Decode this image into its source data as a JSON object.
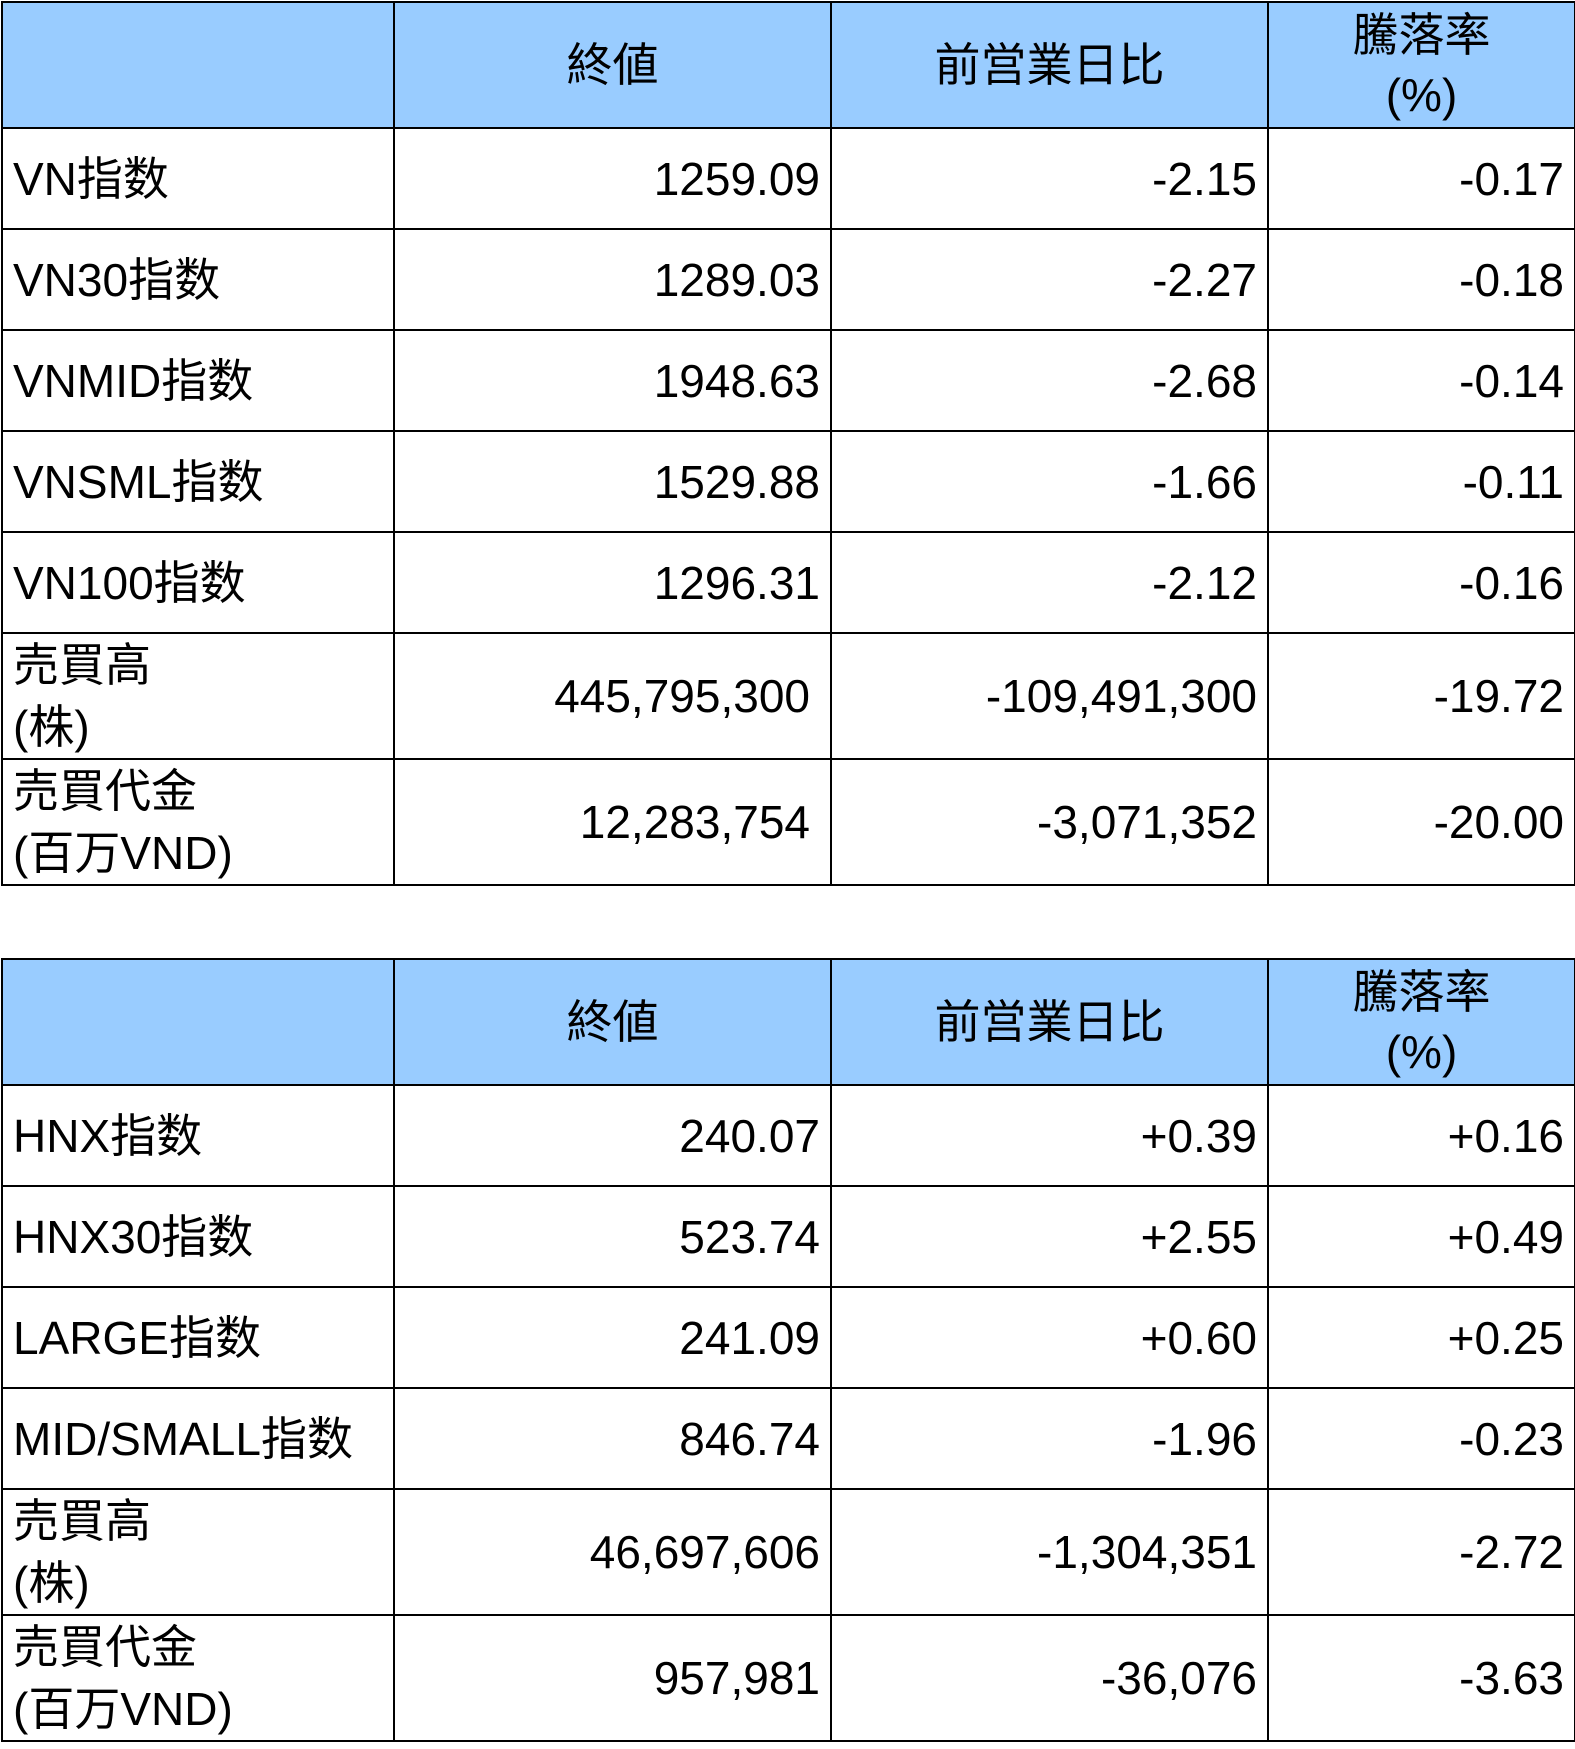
{
  "tables": [
    {
      "header": {
        "close": "終値",
        "change": "前営業日比",
        "pct_line1": "騰落率",
        "pct_line2": "(%)"
      },
      "rows": [
        {
          "label": "VN指数",
          "close": "1259.09",
          "change": "-2.15",
          "pct": "-0.17"
        },
        {
          "label": "VN30指数",
          "close": "1289.03",
          "change": "-2.27",
          "pct": "-0.18"
        },
        {
          "label": "VNMID指数",
          "close": "1948.63",
          "change": "-2.68",
          "pct": "-0.14"
        },
        {
          "label": "VNSML指数",
          "close": "1529.88",
          "change": "-1.66",
          "pct": "-0.11"
        },
        {
          "label": "VN100指数",
          "close": "1296.31",
          "change": "-2.12",
          "pct": "-0.16"
        },
        {
          "label_line1": "売買高",
          "label_line2": "(株)",
          "close": "445,795,300",
          "change": "-109,491,300",
          "pct": "-19.72"
        },
        {
          "label_line1": "売買代金",
          "label_line2": "(百万VND)",
          "close": "12,283,754",
          "change": "-3,071,352",
          "pct": "-20.00"
        }
      ]
    },
    {
      "header": {
        "close": "終値",
        "change": "前営業日比",
        "pct_line1": "騰落率",
        "pct_line2": "(%)"
      },
      "rows": [
        {
          "label": "HNX指数",
          "close": "240.07",
          "change": "+0.39",
          "pct": "+0.16"
        },
        {
          "label": "HNX30指数",
          "close": "523.74",
          "change": "+2.55",
          "pct": "+0.49"
        },
        {
          "label": "LARGE指数",
          "close": "241.09",
          "change": "+0.60",
          "pct": "+0.25"
        },
        {
          "label": "MID/SMALL指数",
          "close": "846.74",
          "change": "-1.96",
          "pct": "-0.23"
        },
        {
          "label_line1": "売買高",
          "label_line2": "(株)",
          "close": "46,697,606",
          "change": "-1,304,351",
          "pct": "-2.72"
        },
        {
          "label_line1": "売買代金",
          "label_line2": "(百万VND)",
          "close": "957,981",
          "change": "-36,076",
          "pct": "-3.63"
        }
      ]
    }
  ],
  "colors": {
    "header_bg": "#99ccff",
    "border": "#000000"
  }
}
